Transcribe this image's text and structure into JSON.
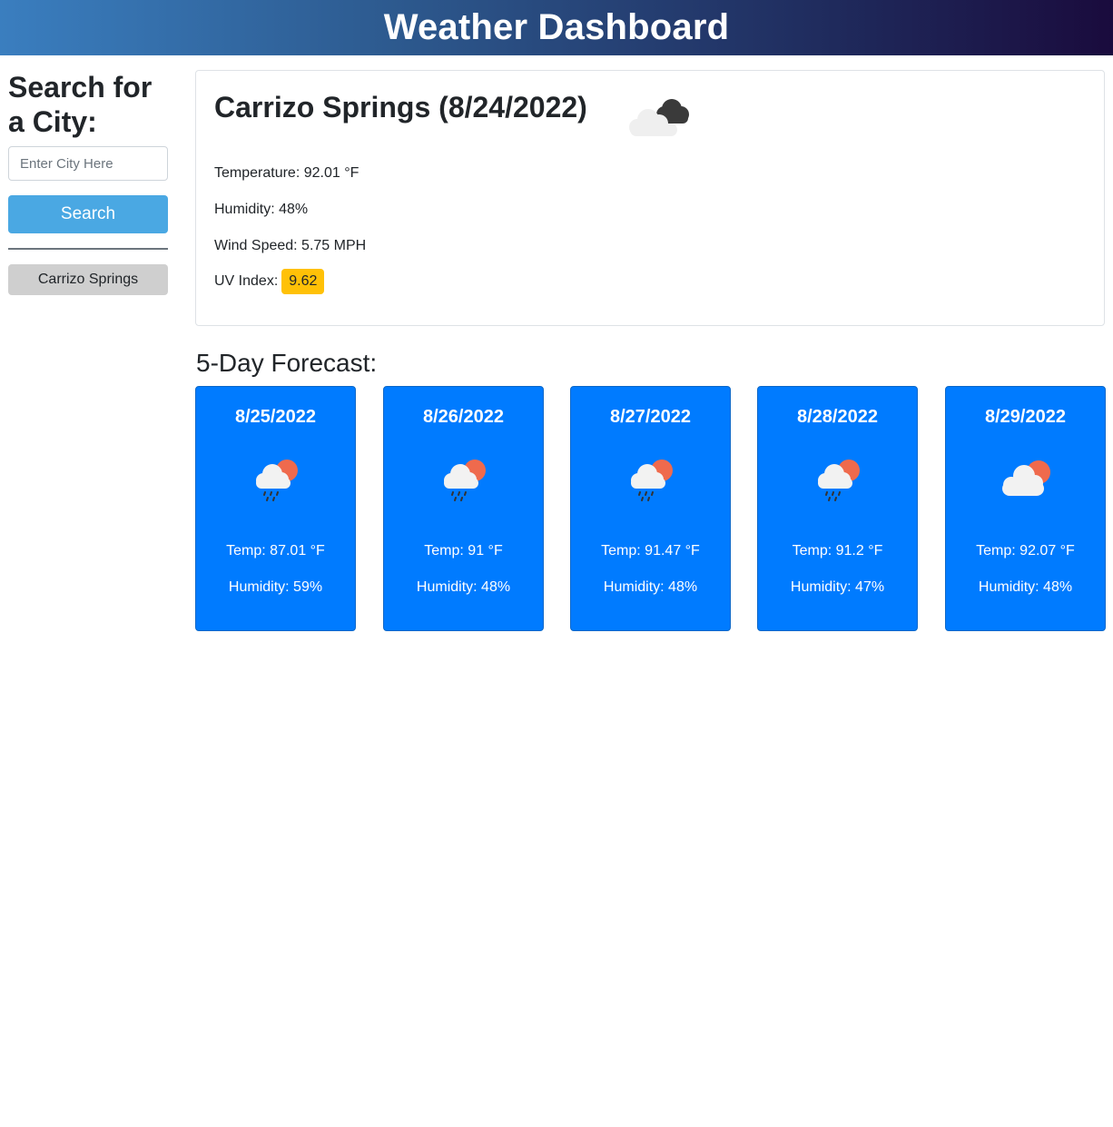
{
  "header": {
    "title": "Weather Dashboard"
  },
  "sidebar": {
    "heading": "Search for a City:",
    "search_placeholder": "Enter City Here",
    "search_label": "Search",
    "history": [
      "Carrizo Springs"
    ]
  },
  "current": {
    "title": "Carrizo Springs (8/24/2022)",
    "icon": "overcast-clouds-icon",
    "temperature": "Temperature: 92.01 °F",
    "humidity": "Humidity: 48%",
    "wind": "Wind Speed: 5.75 MPH",
    "uv_label": "UV Index:",
    "uv_value": "9.62",
    "uv_color": "#ffc107"
  },
  "forecast": {
    "title": "5-Day Forecast:",
    "card_color": "#007bff",
    "days": [
      {
        "date": "8/25/2022",
        "icon": "rain-cloud-sun-icon",
        "temp": "Temp: 87.01 °F",
        "humidity": "Humidity: 59%"
      },
      {
        "date": "8/26/2022",
        "icon": "rain-cloud-sun-icon",
        "temp": "Temp: 91 °F",
        "humidity": "Humidity: 48%"
      },
      {
        "date": "8/27/2022",
        "icon": "rain-cloud-sun-icon",
        "temp": "Temp: 91.47 °F",
        "humidity": "Humidity: 48%"
      },
      {
        "date": "8/28/2022",
        "icon": "rain-cloud-sun-icon",
        "temp": "Temp: 91.2 °F",
        "humidity": "Humidity: 47%"
      },
      {
        "date": "8/29/2022",
        "icon": "cloud-sun-icon",
        "temp": "Temp: 92.07 °F",
        "humidity": "Humidity: 48%"
      }
    ]
  }
}
